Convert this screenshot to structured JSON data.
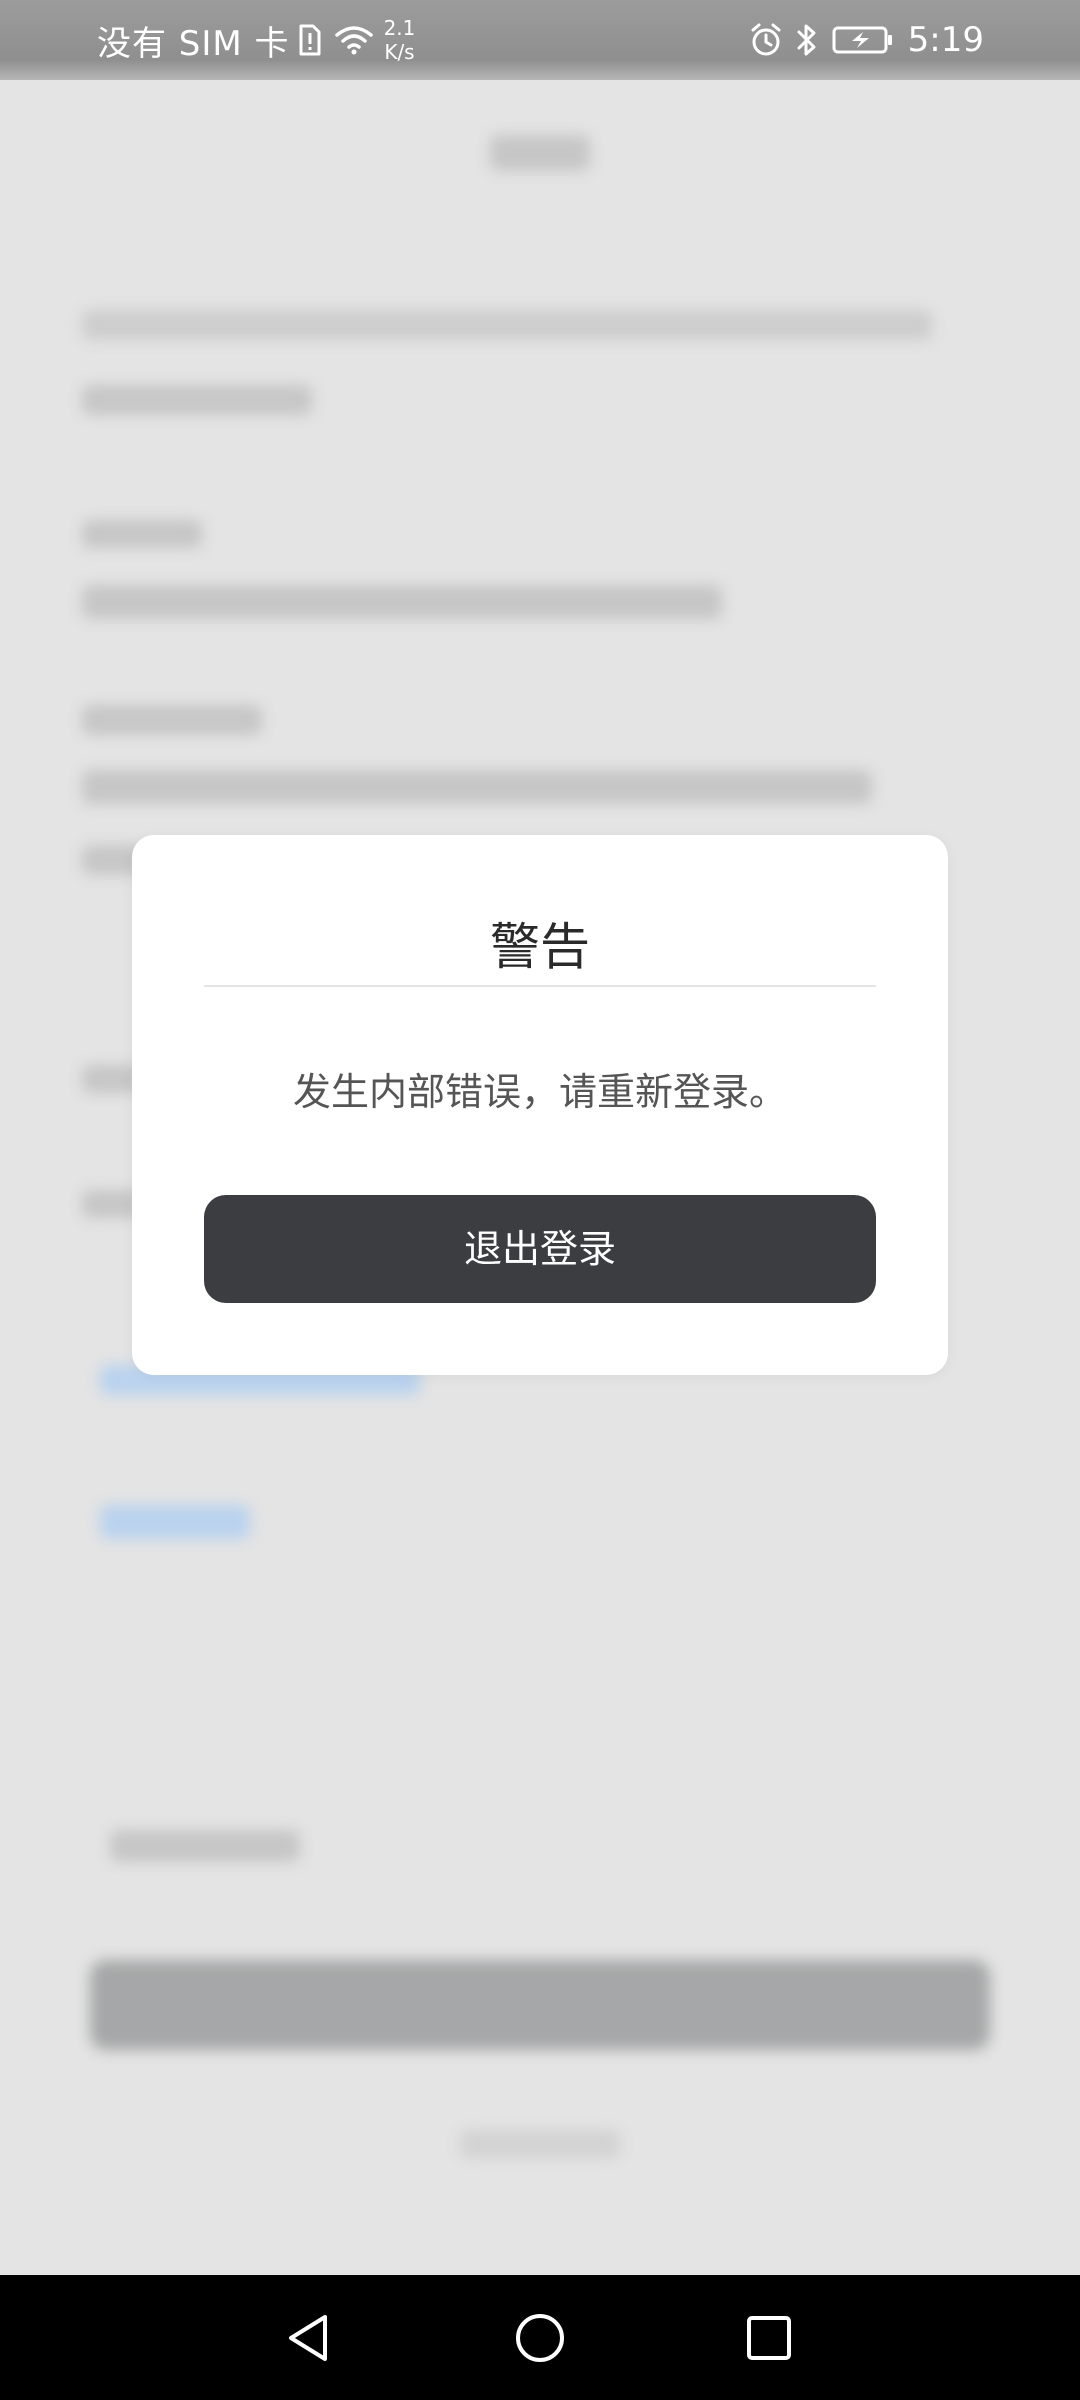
{
  "status_bar": {
    "carrier": "没有 SIM 卡",
    "net_speed_value": "2.1",
    "net_speed_unit": "K/s",
    "time": "5:19",
    "icons": [
      "sim-alert-icon",
      "wifi-icon",
      "alarm-icon",
      "bluetooth-icon",
      "battery-charging-icon"
    ]
  },
  "dialog": {
    "title": "警告",
    "message": "发生内部错误，请重新登录。",
    "logout_button_label": "退出登录"
  },
  "nav_bar": {
    "icons": [
      "back-icon",
      "home-icon",
      "recents-icon"
    ]
  },
  "colors": {
    "dialog_bg": "#ffffff",
    "button_bg": "#3c3d40",
    "button_text": "#ffffff",
    "title_text": "#2a2a2a",
    "message_text": "#555555",
    "scrim": "#e4e4e4",
    "nav_bar_bg": "#000000"
  }
}
